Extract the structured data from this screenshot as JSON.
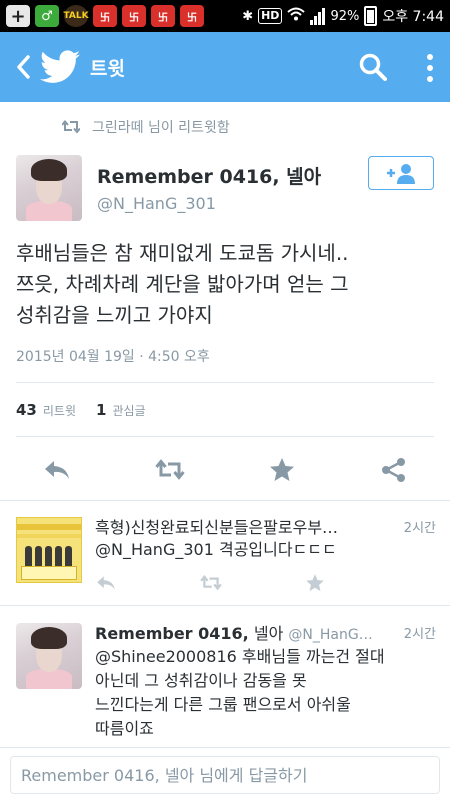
{
  "status_bar": {
    "battery": "92%",
    "time": "오후 7:44",
    "talk_label": "TALK",
    "hd_label": "HD"
  },
  "app_bar": {
    "title": "트윗"
  },
  "retweet_header": {
    "text": "그린라떼 님이 리트윗함"
  },
  "tweet": {
    "author_name": "Remember 0416, 넬아",
    "handle": "@N_HanG_301",
    "text_lines": [
      "후배님들은 참 재미없게 도쿄돔 가시네..",
      "쯔읏, 차례차례 계단을 밟아가며 얻는 그",
      "성취감을 느끼고 가야지"
    ],
    "timestamp": "2015년 04월 19일 · 4:50 오후",
    "retweet_count": "43",
    "retweet_label": "리트윗",
    "favorite_count": "1",
    "favorite_label": "관심글"
  },
  "replies": [
    {
      "author": "흑형)신청완료되신분들은팔로우부…",
      "handle": "",
      "time": "2시간",
      "body_lines": [
        "@N_HanG_301 격공입니다ㄷㄷㄷ"
      ]
    },
    {
      "author": "Remember 0416,",
      "author_suffix": "넬아",
      "handle": "@N_HanG…",
      "time": "2시간",
      "body_lines": [
        "@Shinee2000816 후배님들 까는건 절대",
        "아닌데 그 성취감이나 감동을 못",
        "느낀다는게 다른 그룹 팬으로서 아쉬울",
        "따름이죠"
      ]
    }
  ],
  "reply_box": {
    "placeholder": "Remember 0416, 넬아 님에게 답글하기"
  },
  "colors": {
    "brand": "#55acee",
    "muted": "#8899a6",
    "text": "#292f33",
    "divider": "#e1e8ed"
  },
  "icons": [
    "back-icon",
    "twitter-bird-icon",
    "search-icon",
    "more-icon",
    "retweet-icon",
    "follow-add-icon",
    "reply-icon",
    "favorite-icon",
    "share-icon"
  ]
}
